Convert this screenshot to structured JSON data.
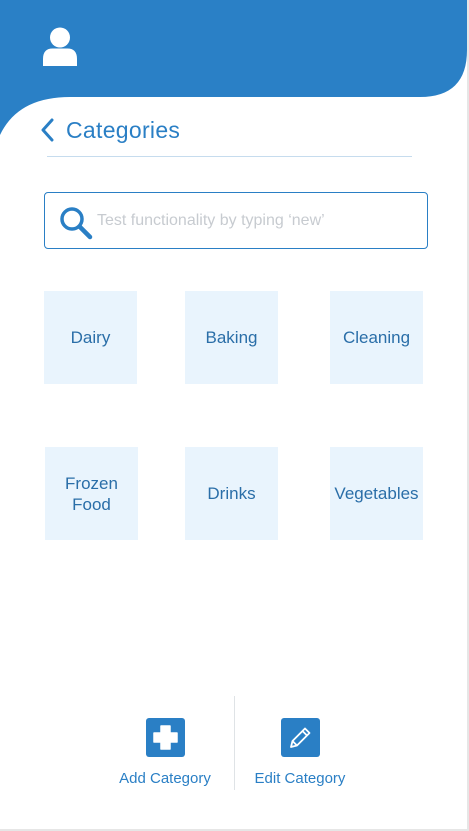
{
  "header": {
    "avatar_icon": "user-icon",
    "background_color": "#2a80c6"
  },
  "title_bar": {
    "back_icon": "chevron-left-icon",
    "title": "Categories"
  },
  "search": {
    "placeholder": "Test functionality by typing ‘new’",
    "value": "",
    "icon": "search-icon"
  },
  "categories": [
    {
      "label": "Dairy"
    },
    {
      "label": "Baking"
    },
    {
      "label": "Cleaning"
    },
    {
      "label": "Frozen Food"
    },
    {
      "label": "Drinks"
    },
    {
      "label": "Vegetables"
    }
  ],
  "actions": {
    "add": {
      "label": "Add Category",
      "icon": "plus-icon"
    },
    "edit": {
      "label": "Edit Category",
      "icon": "pencil-icon"
    }
  },
  "colors": {
    "accent": "#2a7fc5",
    "tile_background": "#e9f4fd",
    "tile_text": "#2a6ea8",
    "placeholder": "#c7cbd0"
  }
}
